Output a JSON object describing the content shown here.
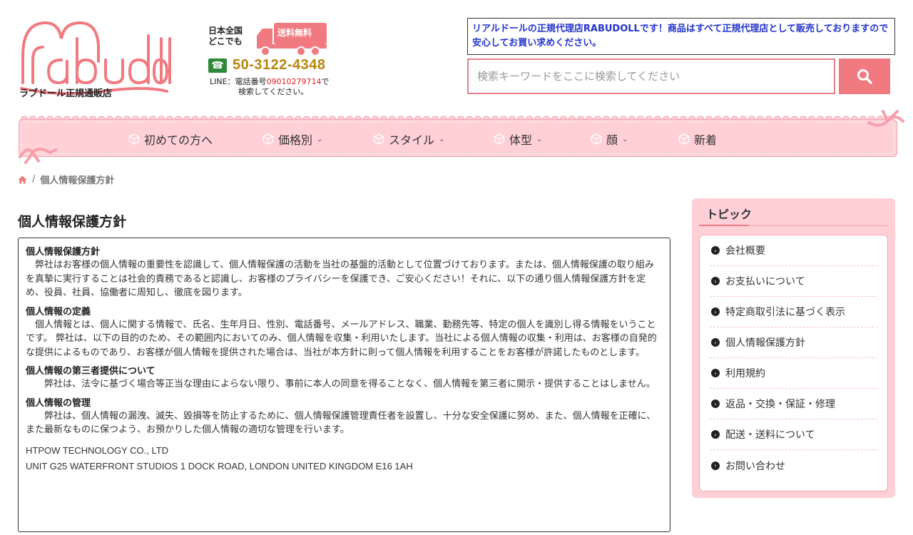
{
  "header": {
    "logo_text": "rabudoll",
    "logo_sub": "ラブドール正規通販店",
    "promo_line1": "日本全国",
    "promo_line2": "どこでも",
    "free_shipping": "送料無料",
    "phone": "50-3122-4348",
    "line_prefix": "LINE：電話番号",
    "line_number": "09010279714",
    "line_suffix": "で",
    "line_info2": "検索してください。",
    "notice": "リアルドールの正規代理店RABUDOLLです！商品はすべて正規代理店として販売しておりますので安心してお買い求めください。",
    "search_placeholder": "検索キーワードをここに検索してください"
  },
  "nav": {
    "items": [
      {
        "label": "初めての方へ",
        "dropdown": false
      },
      {
        "label": "価格別",
        "dropdown": true
      },
      {
        "label": "スタイル",
        "dropdown": true
      },
      {
        "label": "体型",
        "dropdown": true
      },
      {
        "label": "顔",
        "dropdown": true
      },
      {
        "label": "新着",
        "dropdown": false
      }
    ],
    "chevron": "⌄"
  },
  "breadcrumb": {
    "separator": "/",
    "current": "個人情報保護方針"
  },
  "main": {
    "title": "個人情報保護方針",
    "sections": [
      {
        "heading": "個人情報保護方針",
        "body": "　弊社はお客様の個人情報の重要性を認識して、個人情報保護の活動を当社の基盤的活動として位置づけております。または、個人情報保護の取り組みを真摯に実行することは社会的責務であると認識し、お客様のプライバシーを保護でき、ご安心ください！それに、以下の通り個人情報保護方針を定め、役員、社員、協働者に周知し、徹底を図ります。"
      },
      {
        "heading": "個人情報の定義",
        "body": "　個人情報とは、個人に関する情報で、氏名、生年月日、性別、電話番号、メールアドレス、職業、勤務先等、特定の個人を識別し得る情報をいうことです。 弊社は、以下の目的のため、その範囲内においてのみ、個人情報を収集・利用いたします。当社による個人情報の収集・利用は、お客様の自発的な提供によるものであり、お客様が個人情報を提供された場合は、当社が本方針に則って個人情報を利用することをお客様が許諾したものとします。"
      },
      {
        "heading": "個人情報の第三者提供について",
        "body": "　　弊社は、法令に基づく場合等正当な理由によらない限り、事前に本人の同意を得ることなく、個人情報を第三者に開示・提供することはしません。"
      },
      {
        "heading": "個人情報の管理",
        "body": "　　弊社は、個人情報の漏洩、滅失、毀損等を防止するために、個人情報保護管理責任者を設置し、十分な安全保護に努め、また、個人情報を正確に、また最新なものに保つよう、お預かりした個人情報の適切な管理を行います。"
      }
    ],
    "company_name": "HTPOW TECHNOLOGY CO., LTD",
    "company_address": "UNIT G25 WATERFRONT STUDIOS 1 DOCK ROAD, LONDON UNITED KINGDOM E16 1AH"
  },
  "sidebar": {
    "title": "トピック",
    "items": [
      "会社概要",
      "お支払いについて",
      "特定商取引法に基づく表示",
      "個人情報保護方針",
      "利用規約",
      "返品・交換・保証・修理",
      "配送・送料について",
      "お問い合わせ"
    ]
  },
  "colors": {
    "brand_pink": "#f07a80",
    "nav_bg": "#ffd0d6",
    "notice_text": "#2233cc",
    "phone_gold": "#b8860b"
  },
  "icons": {
    "search": "search-icon",
    "home": "home-icon",
    "cube": "cube-icon",
    "phone": "phone-icon",
    "truck": "truck-icon",
    "arrow": "arrow-circle-icon"
  }
}
